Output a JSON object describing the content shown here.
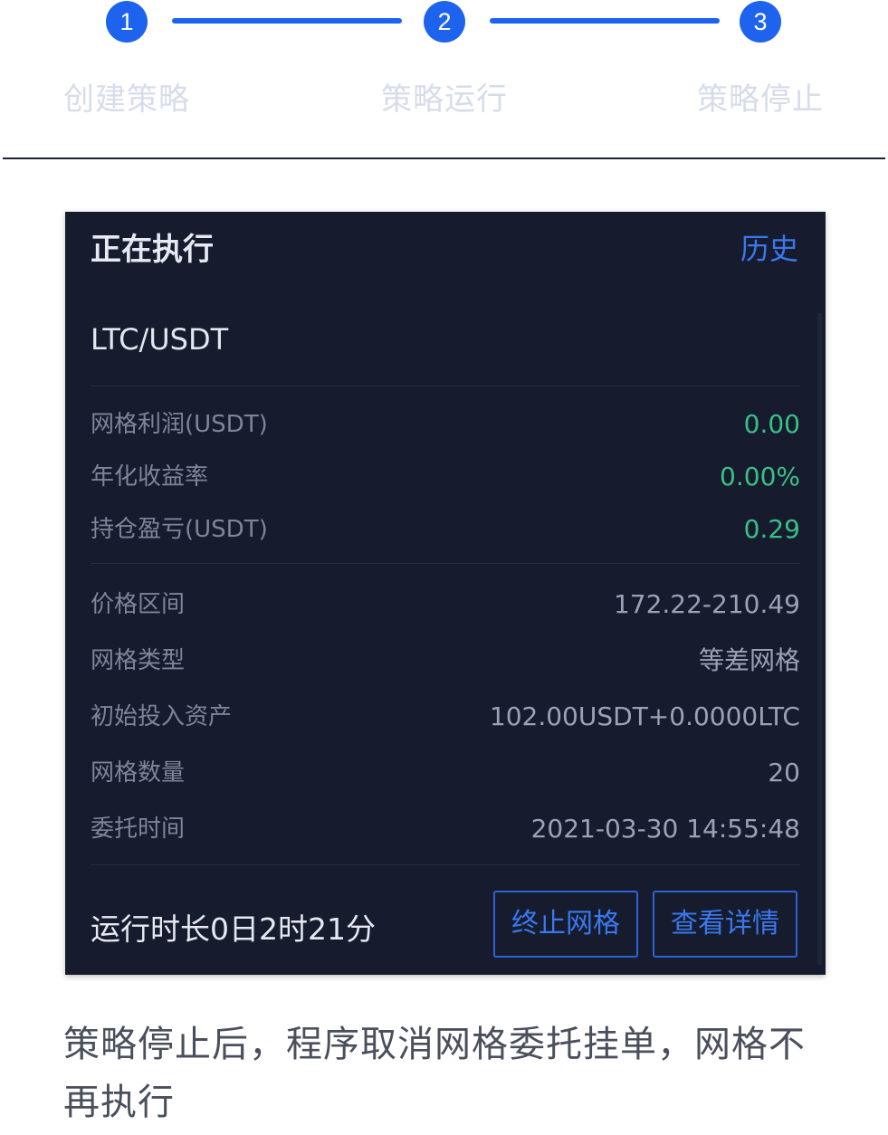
{
  "stepper": {
    "steps": [
      {
        "number": "1",
        "label": "创建策略"
      },
      {
        "number": "2",
        "label": "策略运行"
      },
      {
        "number": "3",
        "label": "策略停止"
      }
    ],
    "accent_color": "#1e63ee",
    "label_color": "#d6dcea"
  },
  "card": {
    "title": "正在执行",
    "history_link": "历史",
    "pair": "LTC/USDT",
    "profit_rows": [
      {
        "label": "网格利润(USDT)",
        "value": "0.00"
      },
      {
        "label": "年化收益率",
        "value": "0.00%"
      },
      {
        "label": "持仓盈亏(USDT)",
        "value": "0.29"
      }
    ],
    "detail_rows": [
      {
        "label": "价格区间",
        "value": "172.22-210.49"
      },
      {
        "label": "网格类型",
        "value": "等差网格"
      },
      {
        "label": "初始投入资产",
        "value": "102.00USDT+0.0000LTC"
      },
      {
        "label": "网格数量",
        "value": "20"
      },
      {
        "label": "委托时间",
        "value": "2021-03-30 14:55:48"
      }
    ],
    "runtime": "运行时长0日2时21分",
    "stop_button": "终止网格",
    "detail_button": "查看详情",
    "background_color": "#161c2e",
    "profit_color": "#3bbf86",
    "link_color": "#3a78ee"
  },
  "caption": "策略停止后，程序取消网格委托挂单，网格不再执行"
}
